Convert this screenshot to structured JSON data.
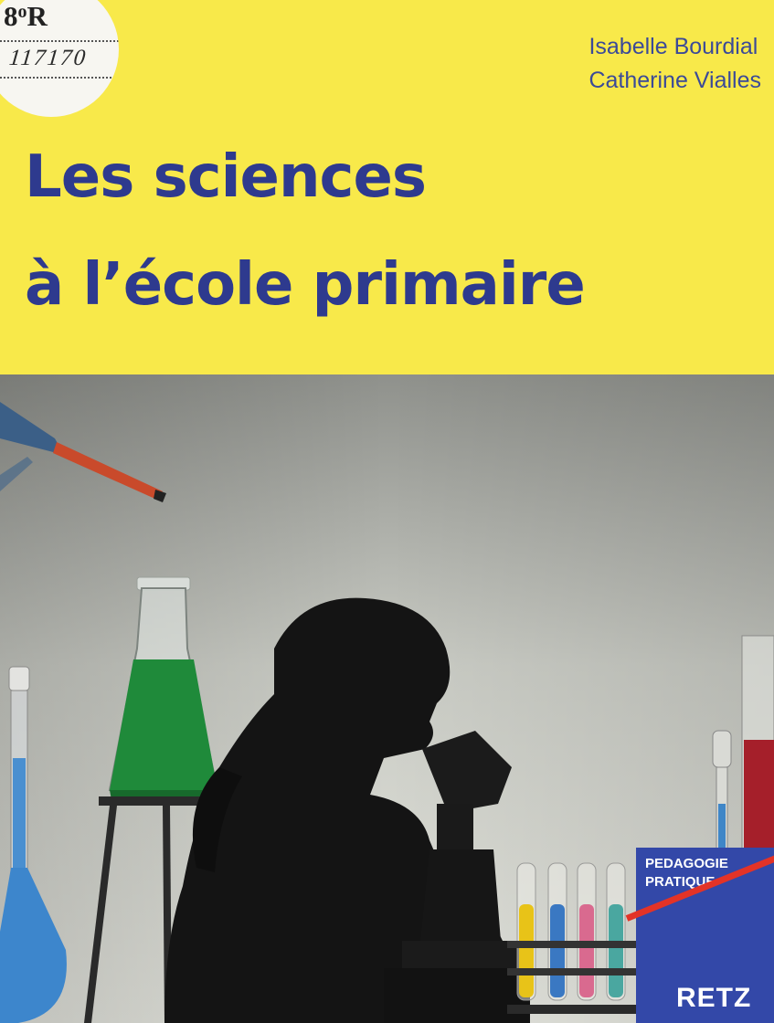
{
  "library_label": {
    "shelf_mark_number": "8",
    "shelf_mark_sup": "o",
    "shelf_mark_letter": "R",
    "call_number": "117170"
  },
  "authors": [
    "Isabelle Bourdial",
    "Catherine Vialles"
  ],
  "title": {
    "line1": "Les sciences",
    "line2": "à l’école primaire"
  },
  "series": {
    "line1": "PEDAGOGIE",
    "line2": "PRATIQUE"
  },
  "publisher": "RETZ",
  "colors": {
    "background": "#f8e94a",
    "title": "#2e3a8e",
    "series_block": "#3348a8",
    "stripe": "#e33327"
  },
  "icons": {
    "photo": "child-with-microscope-and-lab-glassware-silhouette"
  }
}
